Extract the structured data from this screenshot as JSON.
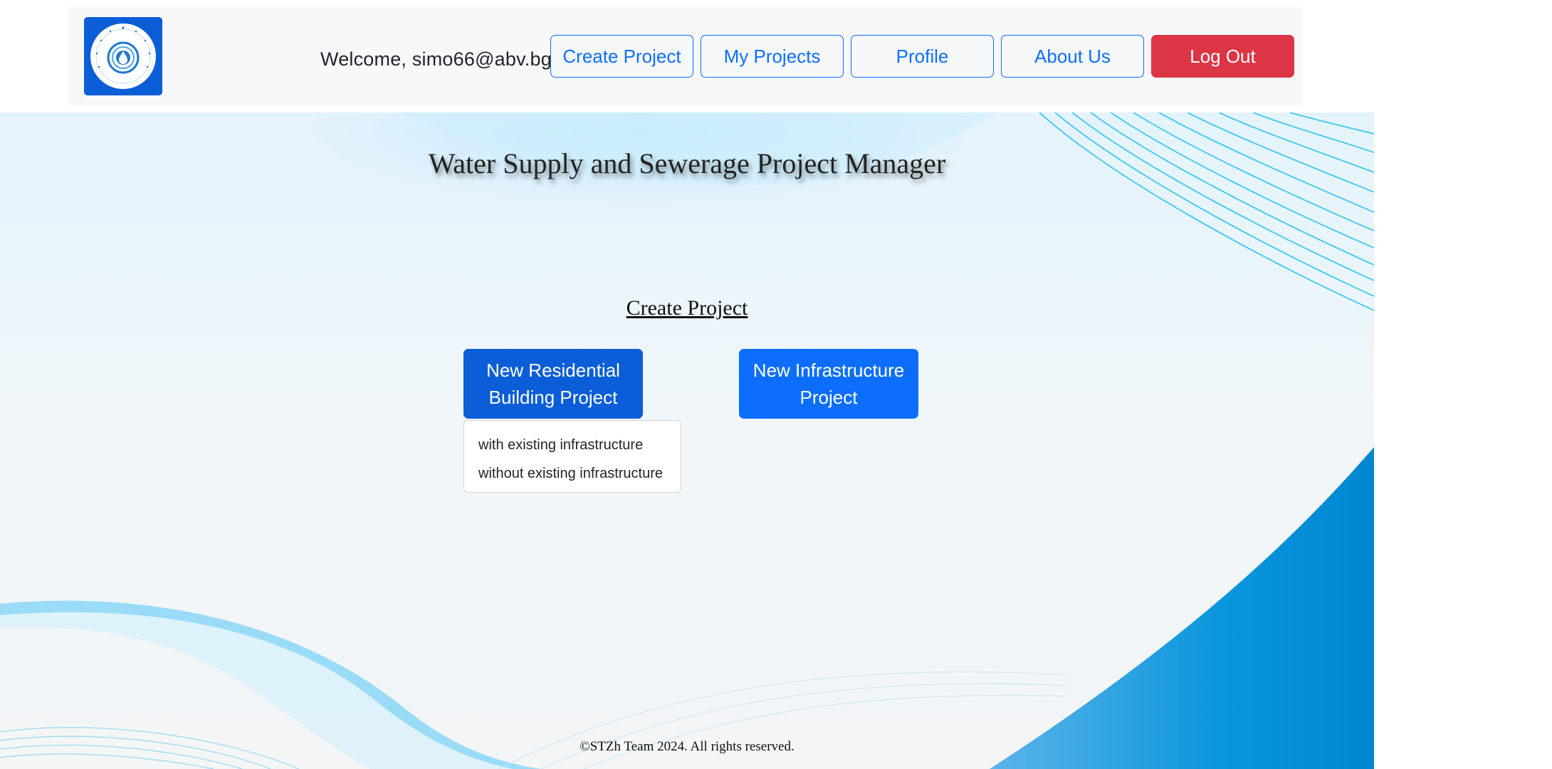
{
  "header": {
    "welcome_text": "Welcome, simo66@abv.bg",
    "nav": {
      "create_project": "Create Project",
      "my_projects": "My Projects",
      "profile": "Profile",
      "about_us": "About Us",
      "log_out": "Log Out"
    }
  },
  "main": {
    "title": "Water Supply and Sewerage Project Manager",
    "section_title": "Create Project",
    "residential_button": "New Residential Building Project",
    "infrastructure_button": "New Infrastructure Project",
    "dropdown_options": [
      "with existing infrastructure",
      "without existing infrastructure"
    ]
  },
  "footer": {
    "text": "©STZh Team 2024. All rights reserved."
  },
  "colors": {
    "primary": "#0d6efd",
    "primary_active": "#0b5ed7",
    "danger": "#dc3545",
    "navbar_bg": "#f7f8fa"
  },
  "icons": {
    "logo": "water-drop-logo-icon"
  }
}
